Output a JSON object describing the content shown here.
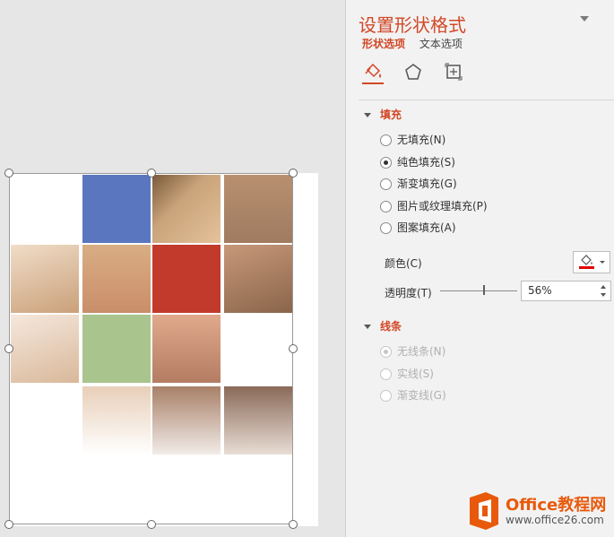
{
  "panel": {
    "title": "设置形状格式",
    "tabs": [
      "形状选项",
      "文本选项"
    ],
    "fill": {
      "header": "填充",
      "options": [
        "无填充(N)",
        "纯色填充(S)",
        "渐变填充(G)",
        "图片或纹理填充(P)",
        "图案填充(A)"
      ],
      "selected": "纯色填充(S)",
      "color_label": "颜色(C)",
      "color_value": "#e00000",
      "transparency_label": "透明度(T)",
      "transparency_value": "56%"
    },
    "line": {
      "header": "线条",
      "options": [
        "无线条(N)",
        "实线(S)",
        "渐变线(G)"
      ],
      "selected": "无线条(N)"
    }
  },
  "watermark": {
    "brand": "Office教程网",
    "url": "www.office26.com"
  },
  "colors": {
    "accent": "#d24726",
    "tile_blue": "#4f6fbf",
    "tile_red": "#c23a2c",
    "tile_green": "#a9c48c"
  }
}
